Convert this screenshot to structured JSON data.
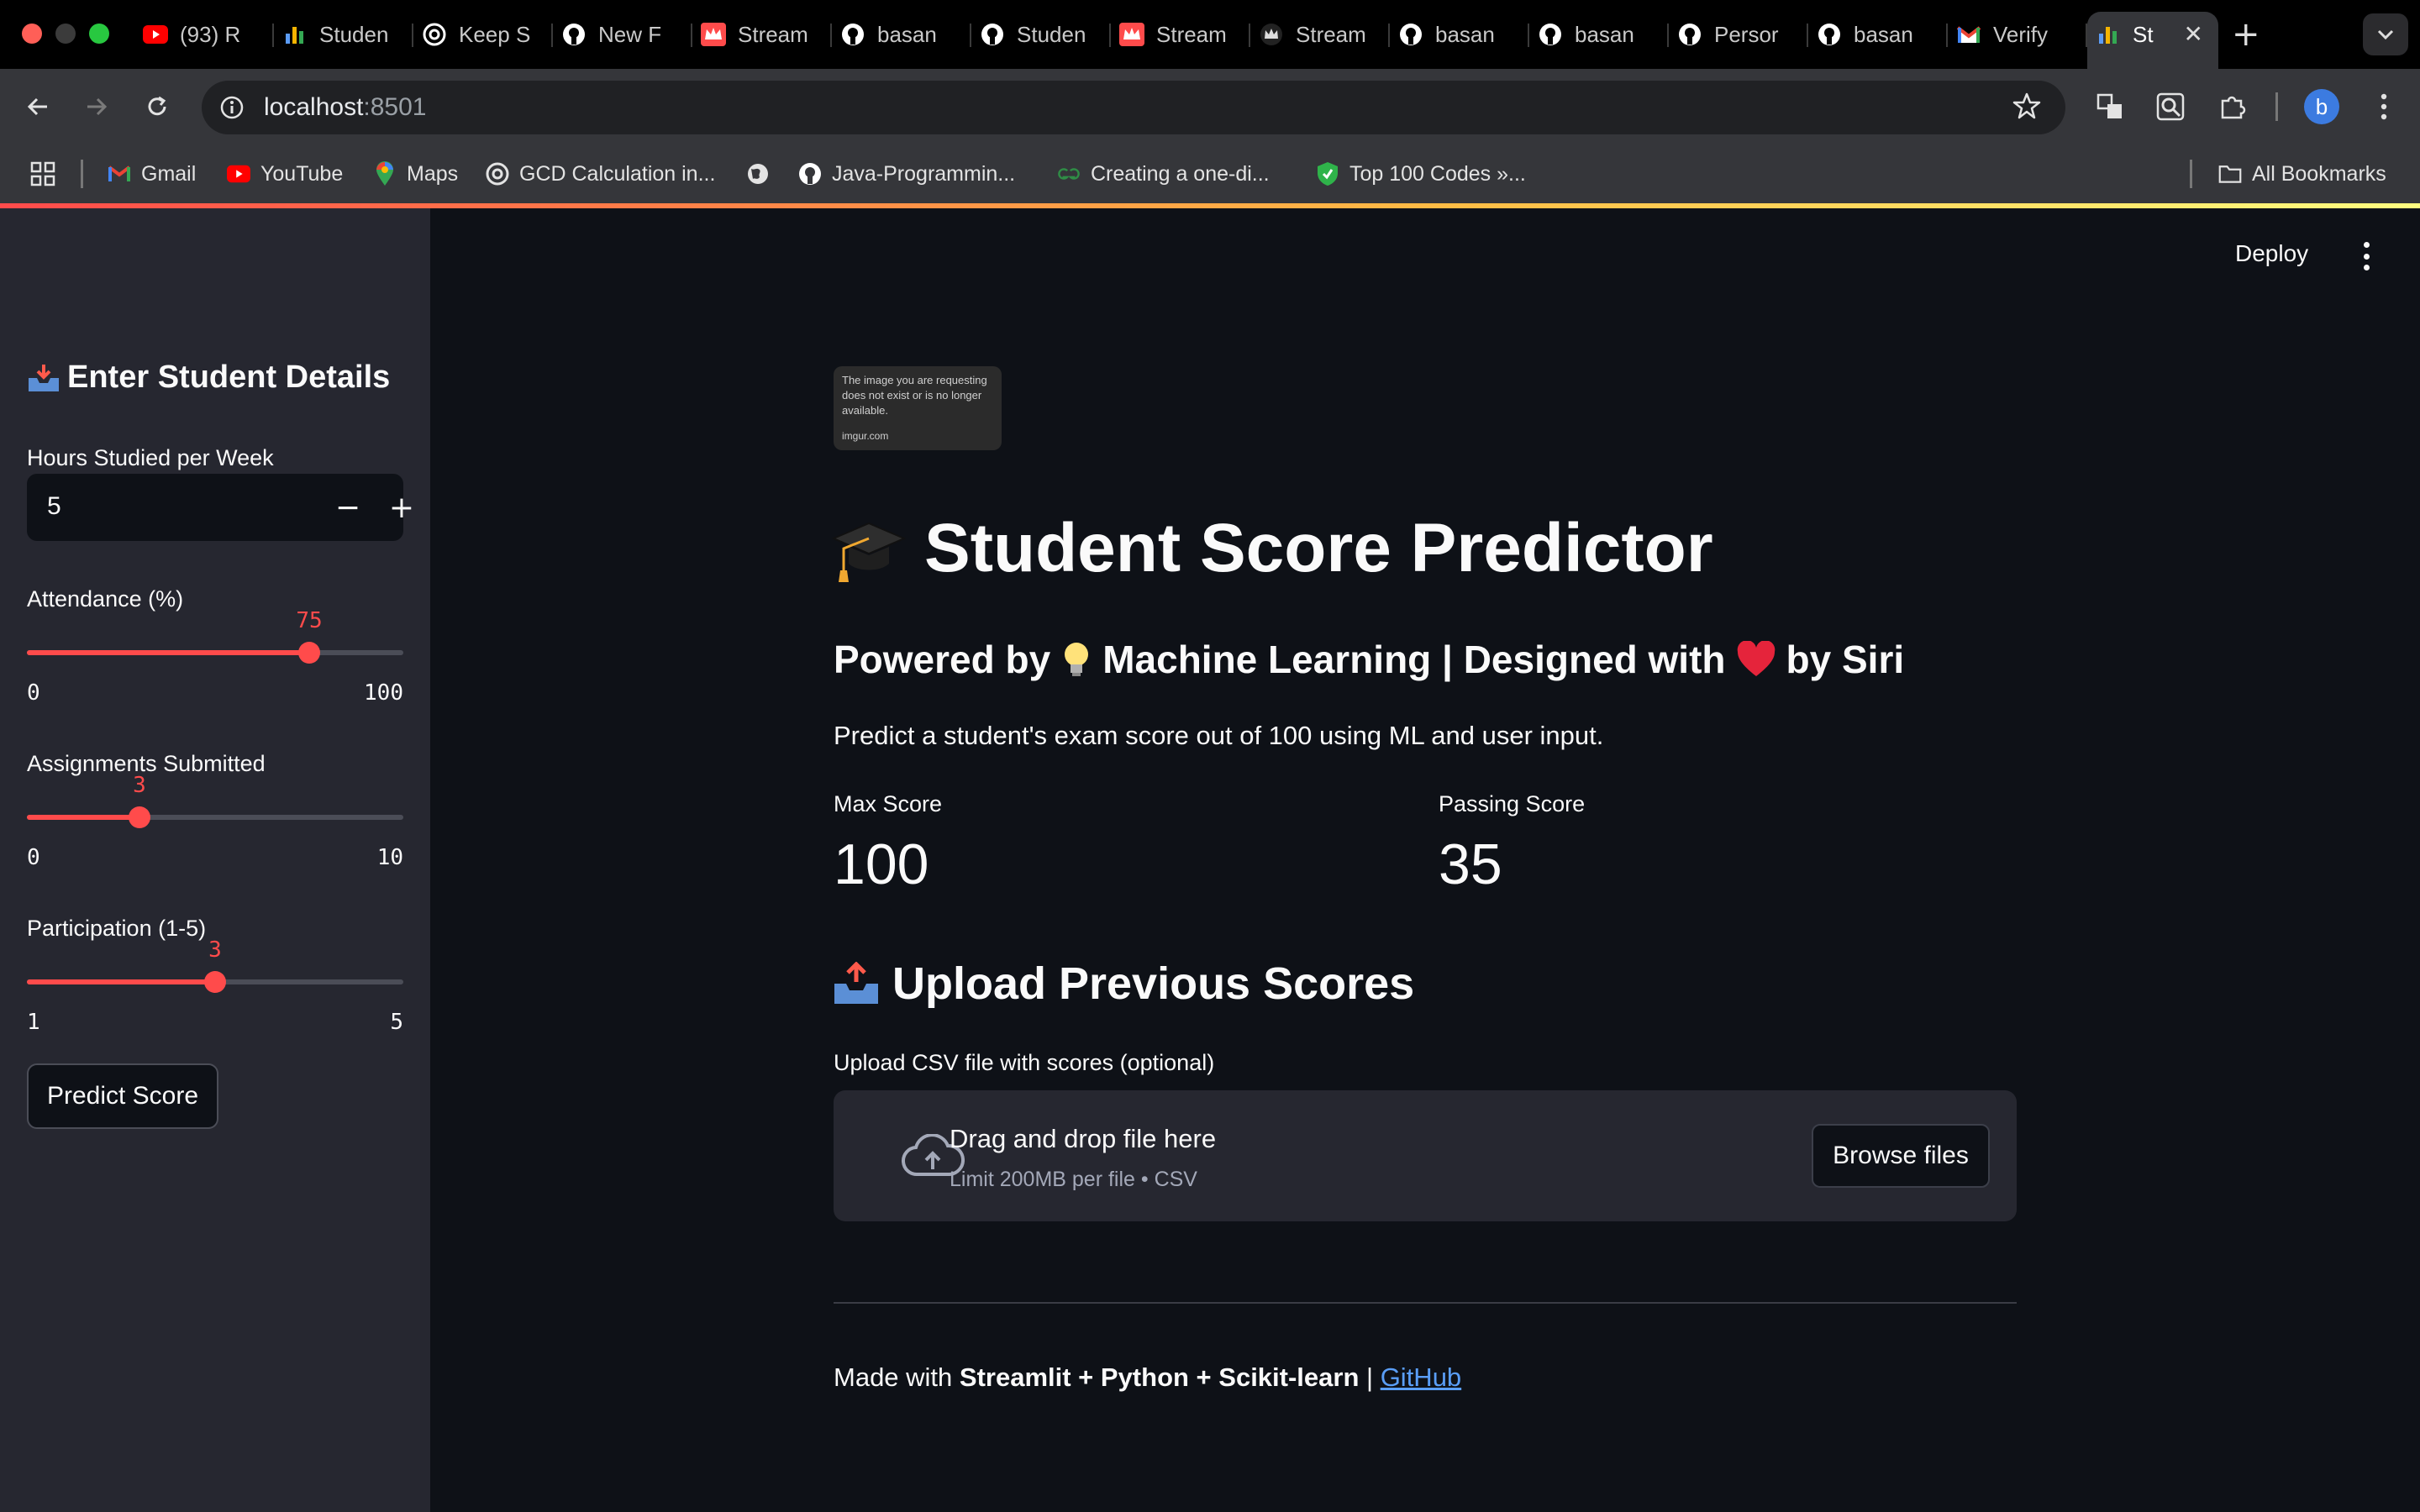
{
  "browser": {
    "tabs": [
      {
        "title": "(93) R",
        "icon": "youtube-icon",
        "color": "#ff0000"
      },
      {
        "title": "Studen",
        "icon": "streamlit-chart-icon",
        "color": "#5b9cf6"
      },
      {
        "title": "Keep S",
        "icon": "openai-icon",
        "color": "#ffffff"
      },
      {
        "title": "New F",
        "icon": "github-icon",
        "color": "#ffffff"
      },
      {
        "title": "Stream",
        "icon": "streamlit-crown-icon",
        "color": "#ff4b4b"
      },
      {
        "title": "basan",
        "icon": "github-icon",
        "color": "#ffffff"
      },
      {
        "title": "Studen",
        "icon": "github-icon",
        "color": "#ffffff"
      },
      {
        "title": "Stream",
        "icon": "streamlit-crown-icon",
        "color": "#ff4b4b"
      },
      {
        "title": "Stream",
        "icon": "streamlit-crown-dark-icon",
        "color": "#cccccc"
      },
      {
        "title": "basan",
        "icon": "github-icon",
        "color": "#ffffff"
      },
      {
        "title": "basan",
        "icon": "github-icon",
        "color": "#ffffff"
      },
      {
        "title": "Persor",
        "icon": "github-icon",
        "color": "#ffffff"
      },
      {
        "title": "basan",
        "icon": "github-icon",
        "color": "#ffffff"
      },
      {
        "title": "Verify",
        "icon": "gmail-icon",
        "color": "#ea4335"
      },
      {
        "title": "St",
        "icon": "streamlit-chart-icon",
        "color": "#5b9cf6",
        "active": true
      }
    ],
    "url_host": "localhost",
    "url_port": ":8501",
    "profile_initial": "b",
    "bookmarks": [
      {
        "label": "Gmail",
        "icon": "gmail-icon"
      },
      {
        "label": "YouTube",
        "icon": "youtube-icon"
      },
      {
        "label": "Maps",
        "icon": "maps-icon"
      },
      {
        "label": "GCD Calculation in...",
        "icon": "openai-icon"
      },
      {
        "label": "",
        "icon": "globe-icon"
      },
      {
        "label": "Java-Programmin...",
        "icon": "github-icon"
      },
      {
        "label": "Creating a one-di...",
        "icon": "geeksforgeeks-icon"
      },
      {
        "label": "Top 100 Codes »...",
        "icon": "shield-icon"
      }
    ],
    "all_bookmarks": "All Bookmarks"
  },
  "sidebar": {
    "title": "Enter Student Details",
    "hours": {
      "label": "Hours Studied per Week",
      "value": "5"
    },
    "attendance": {
      "label": "Attendance (%)",
      "value": "75",
      "min": "0",
      "max": "100",
      "fraction": 0.75
    },
    "assignments": {
      "label": "Assignments Submitted",
      "value": "3",
      "min": "0",
      "max": "10",
      "fraction": 0.3
    },
    "participation": {
      "label": "Participation (1-5)",
      "value": "3",
      "min": "1",
      "max": "5",
      "fraction": 0.5
    },
    "predict_button": "Predict Score"
  },
  "main": {
    "deploy": "Deploy",
    "broken_image_text": "The image you are requesting does not exist or is no longer available.",
    "broken_image_source": "imgur.com",
    "title": "Student Score Predictor",
    "subtitle_part1": "Powered by",
    "subtitle_part2": "Machine Learning | Designed with",
    "subtitle_part3": "by Siri",
    "description": "Predict a student's exam score out of 100 using ML and user input.",
    "metrics": [
      {
        "label": "Max Score",
        "value": "100"
      },
      {
        "label": "Passing Score",
        "value": "35"
      }
    ],
    "upload_title": "Upload Previous Scores",
    "upload_label": "Upload CSV file with scores (optional)",
    "dropzone_title": "Drag and drop file here",
    "dropzone_sub": "Limit 200MB per file • CSV",
    "browse_button": "Browse files",
    "footer_prefix": "Made with ",
    "footer_bold": "Streamlit + Python + Scikit-learn",
    "footer_sep": " | ",
    "footer_link": "GitHub"
  },
  "colors": {
    "accent": "#ff4b4b",
    "background": "#0e1117",
    "sidebar": "#262730",
    "link": "#5a9ef7"
  }
}
